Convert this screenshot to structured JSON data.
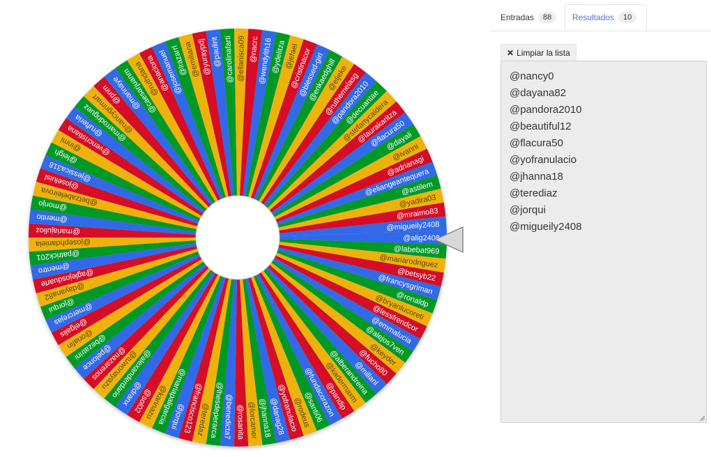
{
  "wheel": {
    "colors": [
      "#3369e8",
      "#009925",
      "#eeb211",
      "#d50f25"
    ],
    "pointer_color": "#d8d8d8",
    "entries": [
      "@alig2408",
      "@labebat969",
      "@mariarodriguez",
      "@betsyb22",
      "@francysgriman",
      "@ronaldp",
      "@bryanlucoreti",
      "@lessfrendcor",
      "@emmalucia",
      "@alejos7ven",
      "@keyder",
      "@fucho80",
      "@millanl",
      "@alberandreina",
      "@kadermaxm",
      "@pandip",
      "@fundacorazon",
      "@santi06",
      "@rodeus",
      "@yofranulacio",
      "@danag28",
      "@jhanna18",
      "@lorcamer",
      "@rosanita",
      "@benedicta7",
      "@lhesdeperarca",
      "@teredaz",
      "@francisco123",
      "@jorqui",
      "@mariapaligarcia",
      "@karinazu",
      "@sol02",
      "@dranx",
      "@alexanderdario",
      "@tuwonayazu",
      "@nazarenos",
      "@pelonce",
      "@bezatrini",
      "@oriafin",
      "@elgalis",
      "@mercrejas",
      "@jorqui",
      "@dayana82",
      "@aglejosduarte",
      "@mentro",
      "@patrick201",
      "@josephdaniela",
      "@mariajulioz",
      "@mentio",
      "@monjo",
      "@betzabeleirova",
      "@joseluisl",
      "@jessica318",
      "@leigh",
      "@inmi",
      "@vencristiana",
      "@rufteria",
      "@marrodriguez",
      "@nancygrimart",
      "@pnm",
      "@marinaye",
      "@caesarjuanm",
      "@ruthdana",
      "@anaclona",
      "@josemanuel",
      "@lrazarrl",
      "@emiliana",
      "@yuraypdj",
      "@paulirit",
      "@carolinafarti",
      "@ellanisca09",
      "@nacrc",
      "@wendylth16",
      "@ydelitza",
      "@jefael",
      "@cristinacor",
      "@blessed-girl",
      "@enkaedghill",
      "@eljeke",
      "@ruthemelasg",
      "@pandora2010",
      "@decuantae",
      "@stefanycaldera",
      "@laurakaritza",
      "@flacura50",
      "@dayali",
      "@ivanni",
      "@adrianagi",
      "@eliangeantequera",
      "@astilem",
      "@yadira03",
      "@mraimo83",
      "@migueily2408"
    ]
  },
  "tabs": {
    "entries": {
      "label": "Entradas",
      "count": "88"
    },
    "results": {
      "label": "Resultados",
      "count": "10"
    }
  },
  "results_panel": {
    "clear_label": "Limpiar la lista",
    "results": [
      "@nancy0",
      "@dayana82",
      "@pandora2010",
      "@beautiful12",
      "@flacura50",
      "@yofranulacio",
      "@jhanna18",
      "@terediaz",
      "@jorqui",
      "@migueily2408"
    ]
  }
}
